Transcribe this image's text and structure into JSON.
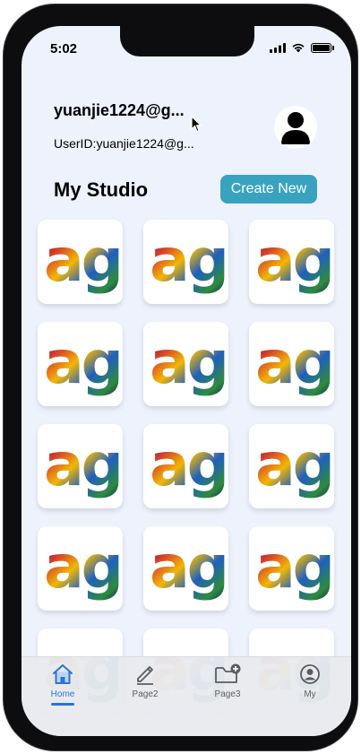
{
  "status_bar": {
    "time": "5:02"
  },
  "profile": {
    "username": "yuanjie1224@g...",
    "user_id": "UserID:yuanjie1224@g..."
  },
  "studio": {
    "title": "My Studio",
    "create_label": "Create New"
  },
  "gallery": {
    "tile_text": "ag",
    "tile_count": 15
  },
  "tabbar": {
    "tabs": [
      {
        "label": "Home",
        "icon": "home-icon",
        "active": true
      },
      {
        "label": "Page2",
        "icon": "pencil-icon",
        "active": false
      },
      {
        "label": "Page3",
        "icon": "folder-add-icon",
        "active": false
      },
      {
        "label": "My",
        "icon": "user-circle-icon",
        "active": false
      }
    ]
  },
  "colors": {
    "background": "#eef2fd",
    "accent": "#39a3bf",
    "tab_active": "#2b74d6"
  }
}
